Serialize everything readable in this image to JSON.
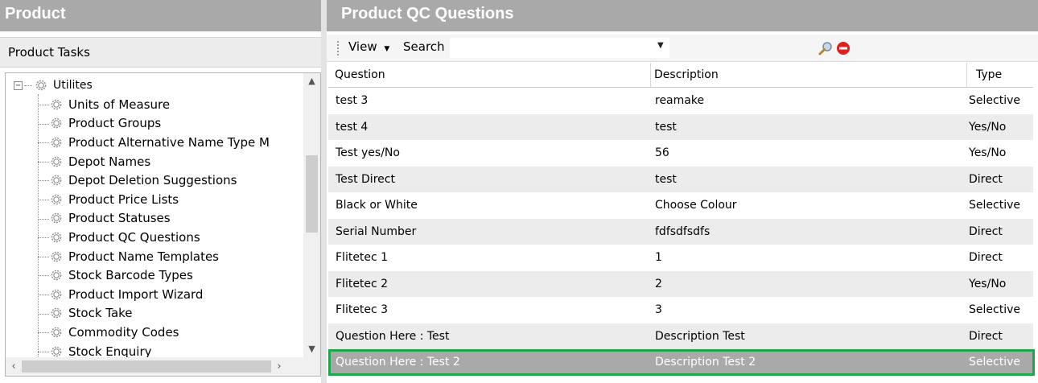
{
  "left_panel": {
    "title": "Product",
    "tasks_label": "Product Tasks",
    "tree": {
      "root_label": "Utilites",
      "items": [
        "Units of Measure",
        "Product Groups",
        "Product Alternative Name Type M",
        "Depot Names",
        "Depot Deletion Suggestions",
        "Product Price Lists",
        "Product Statuses",
        "Product QC Questions",
        "Product Name Templates",
        "Stock Barcode Types",
        "Product Import Wizard",
        "Stock Take",
        "Commodity Codes",
        "Stock Enquiry"
      ]
    }
  },
  "right_panel": {
    "title": "Product QC Questions",
    "toolbar": {
      "view_label": "View",
      "search_label": "Search",
      "search_value": ""
    },
    "grid": {
      "columns": [
        "Question",
        "Description",
        "Type"
      ],
      "rows": [
        [
          "test 3",
          "reamake",
          "Selective"
        ],
        [
          "test 4",
          "test",
          "Yes/No"
        ],
        [
          "Test yes/No",
          "56",
          "Yes/No"
        ],
        [
          "Test Direct",
          "test",
          "Direct"
        ],
        [
          "Black or White",
          "Choose Colour",
          "Selective"
        ],
        [
          "Serial Number",
          "fdfsdfsdfs",
          "Direct"
        ],
        [
          "Flitetec 1",
          "1",
          "Direct"
        ],
        [
          "Flitetec 2",
          "2",
          "Yes/No"
        ],
        [
          "Flitetec 3",
          "3",
          "Selective"
        ],
        [
          "Question Here : Test",
          "Description Test",
          "Direct"
        ],
        [
          "Question Here : Test 2",
          "Description Test 2",
          "Selective"
        ]
      ],
      "selected_row": 10
    }
  },
  "colors": {
    "header_bg": "#a9a9a9",
    "selection_outline": "#1fa64a",
    "alt_row": "#ececec"
  },
  "icons": [
    "minus-expander-icon",
    "gear-icon",
    "search-magnifier-icon",
    "clear-red-icon",
    "dropdown-arrow-icon"
  ]
}
